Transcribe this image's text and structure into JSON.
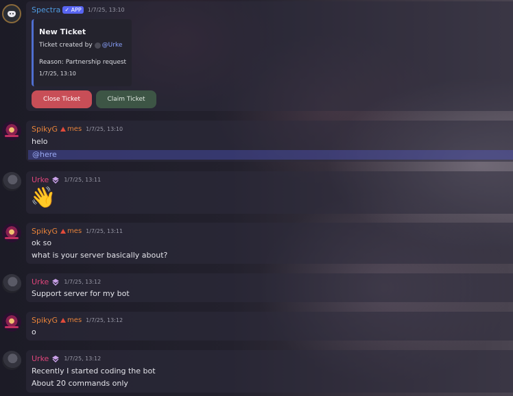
{
  "messages": {
    "m1": {
      "username": "Spectra",
      "app_badge": "✓ APP",
      "timestamp": "1/7/25, 13:10",
      "embed": {
        "title": "New Ticket",
        "created_by_prefix": "Ticket created by",
        "mention": "@Urke",
        "reason": "Reason: Partnership request",
        "timestamp": "1/7/25, 13:10"
      },
      "buttons": {
        "close": "Close Ticket",
        "claim": "Claim Ticket"
      }
    },
    "m2": {
      "username": "SpikyG",
      "tag": "mes",
      "timestamp": "1/7/25, 13:10",
      "lines": [
        "helo"
      ],
      "mention": "@here"
    },
    "m3": {
      "username": "Urke",
      "timestamp": "1/7/25, 13:11",
      "emoji": "👋"
    },
    "m4": {
      "username": "SpikyG",
      "tag": "mes",
      "timestamp": "1/7/25, 13:11",
      "lines": [
        "ok so",
        "what is your server basically about?"
      ]
    },
    "m5": {
      "username": "Urke",
      "timestamp": "1/7/25, 13:12",
      "lines": [
        "Support server for my bot"
      ]
    },
    "m6": {
      "username": "SpikyG",
      "tag": "mes",
      "timestamp": "1/7/25, 13:12",
      "lines": [
        "o"
      ]
    },
    "m7": {
      "username": "Urke",
      "timestamp": "1/7/25, 13:12",
      "lines": [
        "Recently I started coding the bot",
        "About 20 commands only"
      ]
    }
  },
  "colors": {
    "spectra": "#4f9be0",
    "spiky": "#e8833a",
    "urke": "#e0457b",
    "close_button": "#c84e57",
    "claim_button": "#3d5545"
  },
  "icons": {
    "bot_avatar": "discord-icon",
    "tag": "triangle-icon",
    "clan": "clan-badge-icon"
  }
}
